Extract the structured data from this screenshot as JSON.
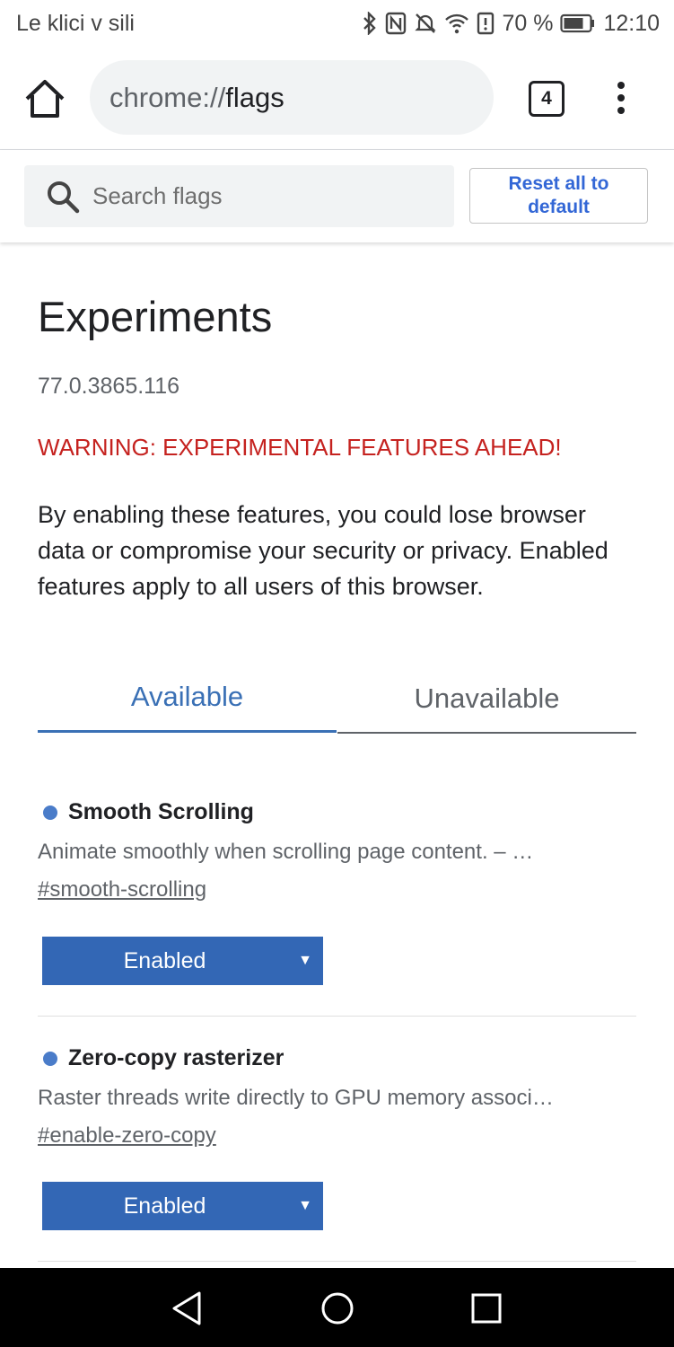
{
  "status_bar": {
    "carrier": "Le klici v sili",
    "battery": "70 %",
    "time": "12:10",
    "icons": [
      "bluetooth-icon",
      "nfc-icon",
      "mute-icon",
      "wifi-icon",
      "alert-icon",
      "battery-icon"
    ]
  },
  "browser": {
    "url_scheme": "chrome://",
    "url_path": "flags",
    "tab_count": "4"
  },
  "search": {
    "placeholder": "Search flags",
    "reset_label": "Reset all to default"
  },
  "page": {
    "title": "Experiments",
    "version": "77.0.3865.116",
    "warning": "WARNING: EXPERIMENTAL FEATURES AHEAD!",
    "intro": "By enabling these features, you could lose browser data or compromise your security or privacy. Enabled features apply to all users of this browser."
  },
  "tabs": [
    {
      "label": "Available",
      "selected": true
    },
    {
      "label": "Unavailable",
      "selected": false
    }
  ],
  "flags": [
    {
      "name": "Smooth Scrolling",
      "description": "Animate smoothly when scrolling page content. – …",
      "link": "#smooth-scrolling",
      "value": "Enabled"
    },
    {
      "name": "Zero-copy rasterizer",
      "description": "Raster threads write directly to GPU memory associ…",
      "link": "#enable-zero-copy",
      "value": "Enabled"
    }
  ],
  "colors": {
    "accent": "#3367b5",
    "warning": "#c5221f",
    "tab_active": "#3a70b5"
  }
}
